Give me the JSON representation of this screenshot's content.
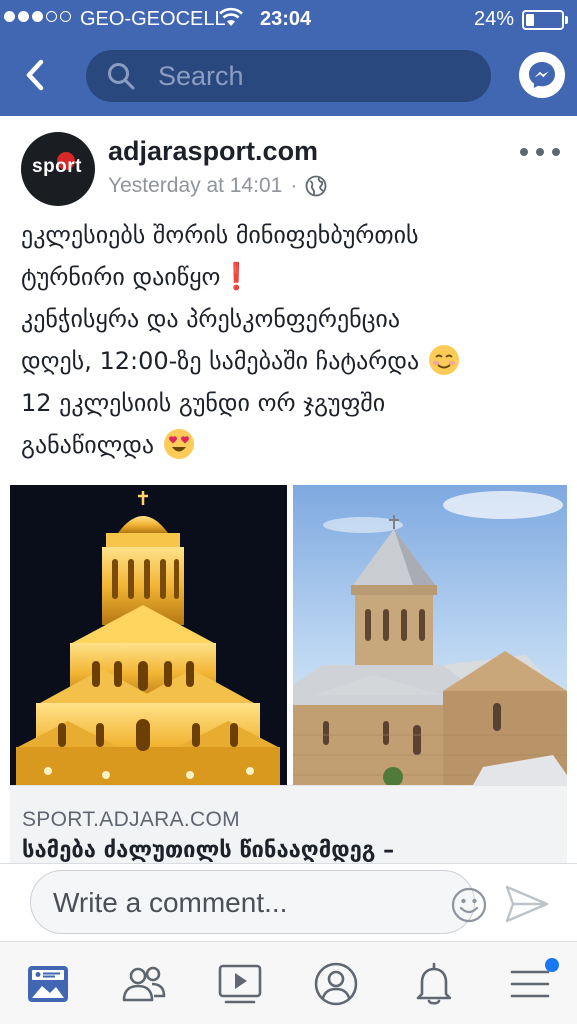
{
  "status_bar": {
    "carrier": "GEO-GEOCELL",
    "time": "23:04",
    "battery": "24%",
    "battery_level": 0.24,
    "signal_bars_filled": 3,
    "signal_bars_total": 5
  },
  "search": {
    "placeholder": "Search"
  },
  "post": {
    "page_name": "adjarasport.com",
    "timestamp": "Yesterday at 14:01",
    "separator": "·",
    "avatar_text": "sport",
    "text_lines": [
      "ეკლესიებს შორის მინიფეხბურთის",
      "ტურნირი დაიწყო",
      "კენჭისყრა და პრესკონფერენცია",
      "დღეს, 12:00-ზე სამებაში ჩატარდა",
      "12 ეკლესიის გუნდი ორ ჯგუფში",
      "განაწილდა"
    ],
    "emojis": {
      "exclamation": "❗",
      "smile": "☺",
      "heart_eyes": "😍"
    },
    "link": {
      "domain": "SPORT.ADJARA.COM",
      "title": "სამება ძალუთილს წინააღმდეგ –"
    }
  },
  "comment": {
    "placeholder": "Write a comment..."
  },
  "tabs": [
    "news-feed",
    "friends",
    "watch",
    "profile",
    "notifications",
    "menu"
  ],
  "colors": {
    "header": "#4267b2",
    "search_bg": "#29487d",
    "search_text": "#8b9dc3",
    "link_bg": "#f2f3f5",
    "active_tab": "#4267b2",
    "inactive_tab": "#606770",
    "badge": "#1877f2"
  }
}
